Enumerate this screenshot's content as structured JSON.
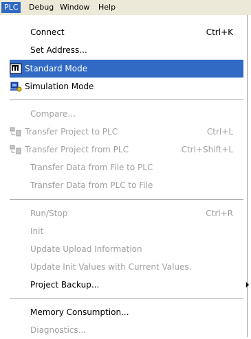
{
  "menubar": {
    "items": [
      {
        "label": "PLC",
        "active": true
      },
      {
        "label": "Debug",
        "active": false
      },
      {
        "label": "Window",
        "active": false
      },
      {
        "label": "Help",
        "active": false
      }
    ]
  },
  "menu": {
    "items": [
      {
        "label": "Connect",
        "shortcut": "Ctrl+K",
        "disabled": false
      },
      {
        "label": "Set Address...",
        "shortcut": "",
        "disabled": false
      },
      {
        "label": "Standard Mode",
        "shortcut": "",
        "disabled": false,
        "highlight": true,
        "icon": "standard-mode-icon"
      },
      {
        "label": "Simulation Mode",
        "shortcut": "",
        "disabled": false,
        "icon": "simulation-mode-icon"
      },
      {
        "label": "Compare...",
        "shortcut": "",
        "disabled": true
      },
      {
        "label": "Transfer Project to PLC",
        "shortcut": "Ctrl+L",
        "disabled": true,
        "icon": "transfer-to-plc-icon"
      },
      {
        "label": "Transfer Project from PLC",
        "shortcut": "Ctrl+Shift+L",
        "disabled": true,
        "icon": "transfer-from-plc-icon"
      },
      {
        "label": "Transfer Data from File to PLC",
        "shortcut": "",
        "disabled": true
      },
      {
        "label": "Transfer Data from PLC to File",
        "shortcut": "",
        "disabled": true
      },
      {
        "label": "Run/Stop",
        "shortcut": "Ctrl+R",
        "disabled": true
      },
      {
        "label": "Init",
        "shortcut": "",
        "disabled": true
      },
      {
        "label": "Update Upload Information",
        "shortcut": "",
        "disabled": true
      },
      {
        "label": "Update Init Values with Current Values.",
        "shortcut": "",
        "disabled": true
      },
      {
        "label": "Project Backup...",
        "shortcut": "",
        "disabled": false,
        "submenu": true
      },
      {
        "label": "Memory Consumption...",
        "shortcut": "",
        "disabled": false
      },
      {
        "label": "Diagnostics...",
        "shortcut": "",
        "disabled": true
      }
    ]
  },
  "colors": {
    "highlight": "#316ac5",
    "disabled_text": "#a0a0a0",
    "menubar_bg": "#ece9d8"
  }
}
